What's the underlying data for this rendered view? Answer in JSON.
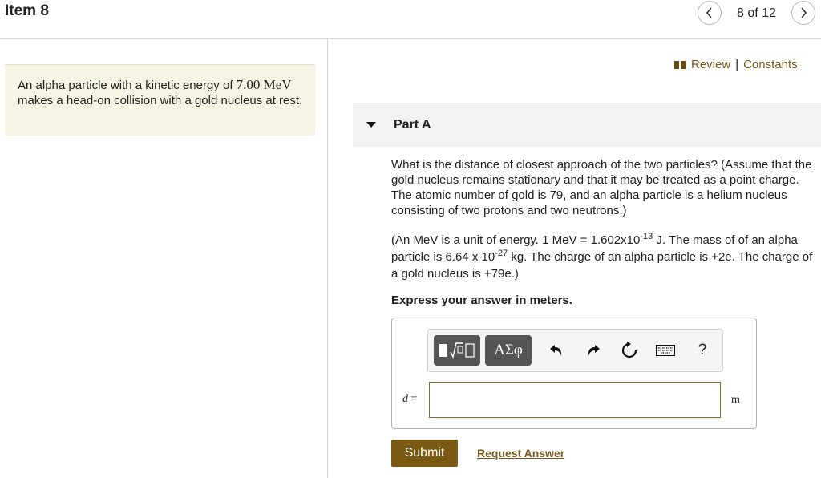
{
  "header": {
    "item_title": "Item 8",
    "counter": "8 of 12",
    "prev_icon": "chevron-left-icon",
    "next_icon": "chevron-right-icon"
  },
  "problem": {
    "text_before": "An alpha particle with a kinetic energy of ",
    "energy": "7.00 MeV",
    "text_after": " makes a head-on collision with a gold nucleus at rest."
  },
  "review": {
    "icon": "book-icon",
    "review_label": "Review",
    "separator": "|",
    "constants_label": "Constants"
  },
  "part": {
    "label": "Part A",
    "question": "What is the distance of closest approach of the two particles? (Assume that the gold nucleus remains stationary and that it may be treated as a point charge. The atomic number of gold is 79, and an alpha particle is a helium nucleus consisting of two protons and two neutrons.)",
    "note_1": "(An MeV is a unit of energy. 1 MeV = 1.602x10",
    "note_exp1": "-13",
    "note_2": " J.  The mass of of an alpha particle is 6.64 x 10",
    "note_exp2": "-27",
    "note_3": " kg.  The charge of an alpha particle is +2e.  The charge of a gold nucleus is +79e.)",
    "instruction": "Express your answer in meters."
  },
  "toolbar": {
    "symbol_label": "ΑΣφ",
    "help_label": "?",
    "icons": [
      "templates-icon",
      "greek-symbols-icon",
      "undo-icon",
      "redo-icon",
      "reset-icon",
      "keyboard-icon",
      "help-icon"
    ]
  },
  "answer": {
    "variable": "d",
    "equals": "=",
    "value": "",
    "unit": "m"
  },
  "actions": {
    "submit_label": "Submit",
    "request_label": "Request Answer"
  },
  "colors": {
    "accent": "#7a5a12",
    "panel_bg": "#f5f3e4",
    "part_bar_bg": "#f2f2f2"
  }
}
